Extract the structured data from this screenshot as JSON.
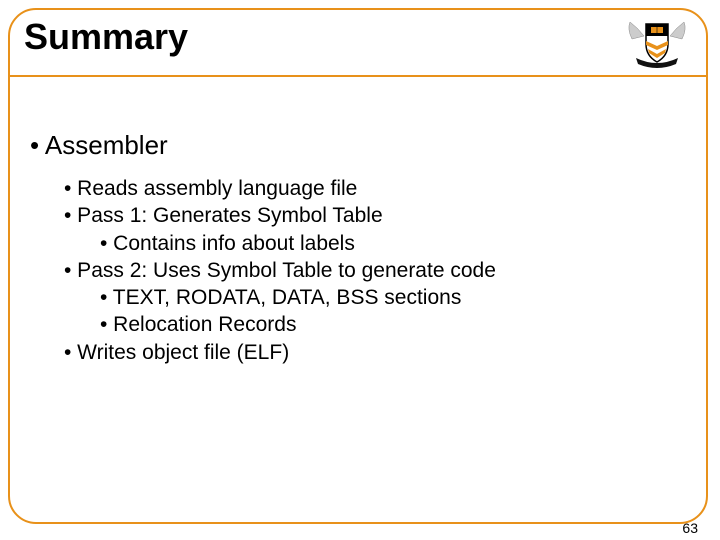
{
  "title": "Summary",
  "logo_name": "princeton-shield-logo",
  "bullets": {
    "lvl1": "• Assembler",
    "items": [
      {
        "level": 2,
        "text": "• Reads assembly language file"
      },
      {
        "level": 2,
        "text": "• Pass 1: Generates Symbol Table"
      },
      {
        "level": 3,
        "text": "• Contains info about labels"
      },
      {
        "level": 2,
        "text": "• Pass 2: Uses Symbol Table to generate code"
      },
      {
        "level": 3,
        "text": "• TEXT, RODATA, DATA, BSS sections"
      },
      {
        "level": 3,
        "text": "• Relocation Records"
      },
      {
        "level": 2,
        "text": "• Writes object file (ELF)"
      }
    ]
  },
  "page_number": "63"
}
